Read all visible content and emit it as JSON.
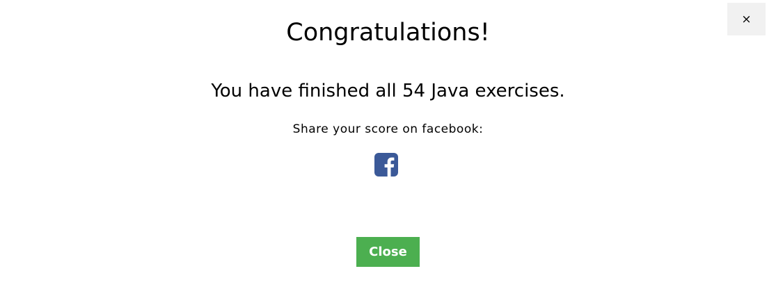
{
  "modal": {
    "close_x_label": "×",
    "title": "Congratulations!",
    "message": "You have finished all 54 Java exercises.",
    "share_label": "Share your score on facebook:",
    "facebook_icon": "facebook-square-icon",
    "close_button_label": "Close"
  },
  "colors": {
    "facebook_blue": "#3b5998",
    "close_button_green": "#4caf50",
    "close_x_background": "#f1f1f1"
  }
}
